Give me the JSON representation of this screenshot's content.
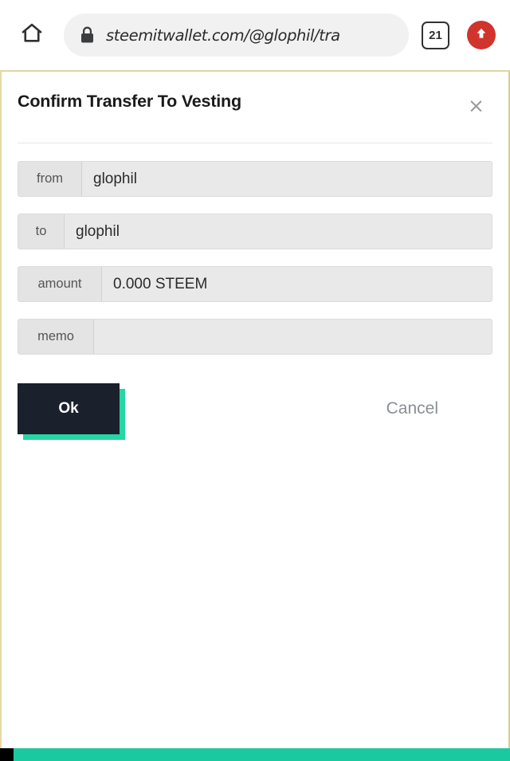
{
  "browser": {
    "home_icon": "home-icon",
    "lock_icon": "lock-icon",
    "url": "steemitwallet.com/@glophil/tra",
    "tab_count": "21",
    "update_icon": "upload-arrow-icon",
    "update_color": "#d0342c"
  },
  "modal": {
    "title": "Confirm Transfer To Vesting",
    "close_label": "×",
    "rows": [
      {
        "label": "from",
        "value": "glophil"
      },
      {
        "label": "to",
        "value": "glophil"
      },
      {
        "label": "amount",
        "value": "0.000 STEEM"
      },
      {
        "label": "memo",
        "value": ""
      }
    ],
    "ok_label": "Ok",
    "cancel_label": "Cancel",
    "ok_bg": "#1a202c",
    "ok_shadow": "#26d6a5"
  },
  "bottom": {
    "accent_color": "#1bc9a0"
  }
}
